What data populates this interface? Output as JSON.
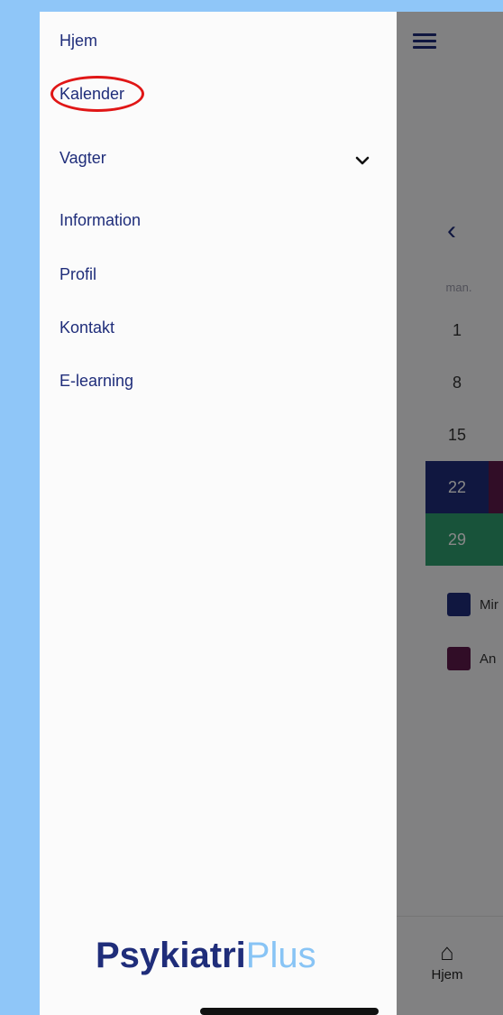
{
  "drawer": {
    "items": [
      {
        "label": "Hjem"
      },
      {
        "label": "Kalender"
      },
      {
        "label": "Vagter"
      },
      {
        "label": "Information"
      },
      {
        "label": "Profil"
      },
      {
        "label": "Kontakt"
      },
      {
        "label": "E-learning"
      }
    ],
    "expand_icon": "chevron-down-icon",
    "brand": {
      "part1": "Psykiatri",
      "part2": "Plus"
    },
    "highlighted_item": "Kalender"
  },
  "calendar": {
    "nav_prev_icon": "chevron-left-icon",
    "weekday": "man.",
    "days": [
      "1",
      "8",
      "15",
      "22",
      "29"
    ]
  },
  "legend": [
    {
      "label": "Mir",
      "color": "#1f2d7a"
    },
    {
      "label": "An",
      "color": "#5e1a4b"
    }
  ],
  "bottom_nav": {
    "home_label": "Hjem",
    "home_icon": "home-icon"
  },
  "colors": {
    "primary": "#1f2d7a",
    "accent_green": "#2e9e6f",
    "brand_light": "#88c4f5",
    "highlight": "#e01616"
  }
}
